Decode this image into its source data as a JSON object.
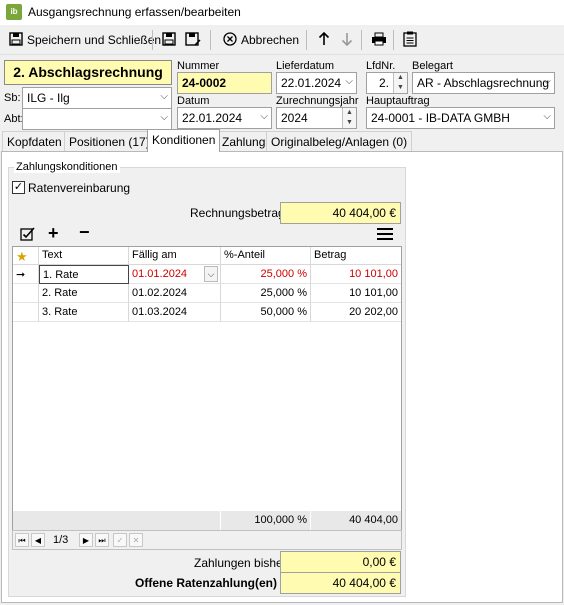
{
  "window": {
    "title": "Ausgangsrechnung erfassen/bearbeiten",
    "app_icon": "ib"
  },
  "toolbar": {
    "save_close": "Speichern und Schließen",
    "cancel": "Abbrechen"
  },
  "header": {
    "doc_type": "2. Abschlagsrechnung",
    "nummer_label": "Nummer",
    "nummer": "24-0002",
    "lieferdatum_label": "Lieferdatum",
    "lieferdatum": "22.01.2024",
    "lfdnr_label": "LfdNr.",
    "lfdnr": "2.",
    "belegart_label": "Belegart",
    "belegart": "AR - Abschlagsrechnung",
    "sb_label": "Sb:",
    "sb": "ILG - Ilg",
    "abt_label": "Abt:",
    "abt": "",
    "datum_label": "Datum",
    "datum": "22.01.2024",
    "zurechnungsjahr_label": "Zurechnungsjahr",
    "zurechnungsjahr": "2024",
    "hauptauftrag_label": "Hauptauftrag",
    "hauptauftrag": "24-0001 - IB-DATA GMBH"
  },
  "tabs": [
    "Kopfdaten",
    "Positionen (17)",
    "Konditionen",
    "Zahlung",
    "Originalbeleg/Anlagen (0)"
  ],
  "conditions": {
    "group_title": "Zahlungskonditionen",
    "ratenvereinbarung_label": "Ratenvereinbarung",
    "ratenvereinbarung_checked": true,
    "rechnungsbetrag_label": "Rechnungsbetrag",
    "rechnungsbetrag": "40 404,00 €",
    "columns": [
      "Text",
      "Fällig am",
      "%-Anteil",
      "Betrag"
    ],
    "rows": [
      {
        "text": "1. Rate",
        "faellig": "01.01.2024",
        "anteil": "25,000 %",
        "betrag": "10 101,00"
      },
      {
        "text": "2. Rate",
        "faellig": "01.02.2024",
        "anteil": "25,000 %",
        "betrag": "10 101,00"
      },
      {
        "text": "3. Rate",
        "faellig": "01.03.2024",
        "anteil": "50,000 %",
        "betrag": "20 202,00"
      }
    ],
    "sum_anteil": "100,000 %",
    "sum_betrag": "40 404,00",
    "nav_position": "1/3",
    "zahlungen_bisher_label": "Zahlungen bisher",
    "zahlungen_bisher": "0,00 €",
    "offene_label": "Offene Ratenzahlung(en)",
    "offene": "40 404,00 €"
  }
}
